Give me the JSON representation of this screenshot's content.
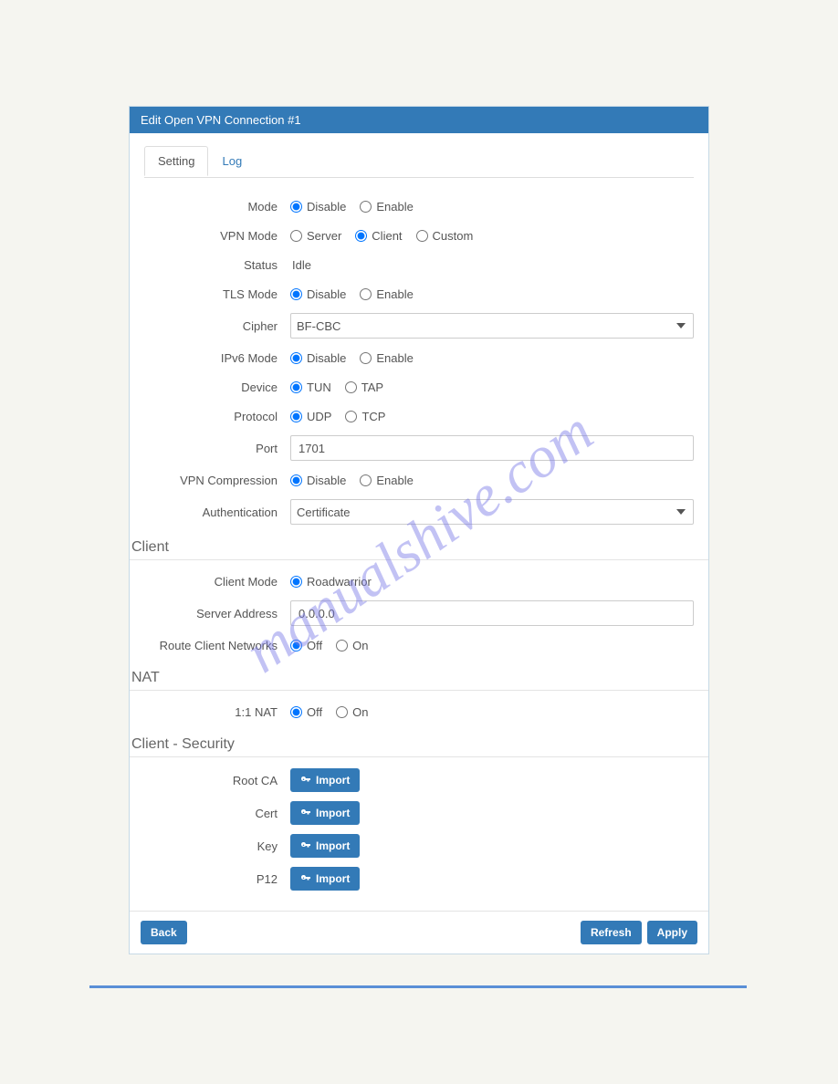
{
  "watermark": "manualshive.com",
  "panel": {
    "title": "Edit Open VPN Connection #1",
    "tabs": {
      "setting": "Setting",
      "log": "Log"
    },
    "fields": {
      "mode": {
        "label": "Mode",
        "options": {
          "disable": "Disable",
          "enable": "Enable"
        },
        "selected": "disable"
      },
      "vpn_mode": {
        "label": "VPN Mode",
        "options": {
          "server": "Server",
          "client": "Client",
          "custom": "Custom"
        },
        "selected": "client"
      },
      "status": {
        "label": "Status",
        "value": "Idle"
      },
      "tls_mode": {
        "label": "TLS Mode",
        "options": {
          "disable": "Disable",
          "enable": "Enable"
        },
        "selected": "disable"
      },
      "cipher": {
        "label": "Cipher",
        "value": "BF-CBC"
      },
      "ipv6_mode": {
        "label": "IPv6 Mode",
        "options": {
          "disable": "Disable",
          "enable": "Enable"
        },
        "selected": "disable"
      },
      "device": {
        "label": "Device",
        "options": {
          "tun": "TUN",
          "tap": "TAP"
        },
        "selected": "tun"
      },
      "protocol": {
        "label": "Protocol",
        "options": {
          "udp": "UDP",
          "tcp": "TCP"
        },
        "selected": "udp"
      },
      "port": {
        "label": "Port",
        "value": "1701"
      },
      "vpn_compression": {
        "label": "VPN Compression",
        "options": {
          "disable": "Disable",
          "enable": "Enable"
        },
        "selected": "disable"
      },
      "authentication": {
        "label": "Authentication",
        "value": "Certificate"
      }
    },
    "section_client": {
      "title": "Client",
      "client_mode": {
        "label": "Client Mode",
        "options": {
          "roadwarrior": "Roadwarrior"
        },
        "selected": "roadwarrior"
      },
      "server_address": {
        "label": "Server Address",
        "value": "0.0.0.0"
      },
      "route_client_networks": {
        "label": "Route Client Networks",
        "options": {
          "off": "Off",
          "on": "On"
        },
        "selected": "off"
      }
    },
    "section_nat": {
      "title": "NAT",
      "nat_1_1": {
        "label": "1:1 NAT",
        "options": {
          "off": "Off",
          "on": "On"
        },
        "selected": "off"
      }
    },
    "section_security": {
      "title": "Client - Security",
      "import_label": "Import",
      "root_ca": {
        "label": "Root CA"
      },
      "cert": {
        "label": "Cert"
      },
      "key": {
        "label": "Key"
      },
      "p12": {
        "label": "P12"
      }
    },
    "footer": {
      "back": "Back",
      "refresh": "Refresh",
      "apply": "Apply"
    }
  }
}
